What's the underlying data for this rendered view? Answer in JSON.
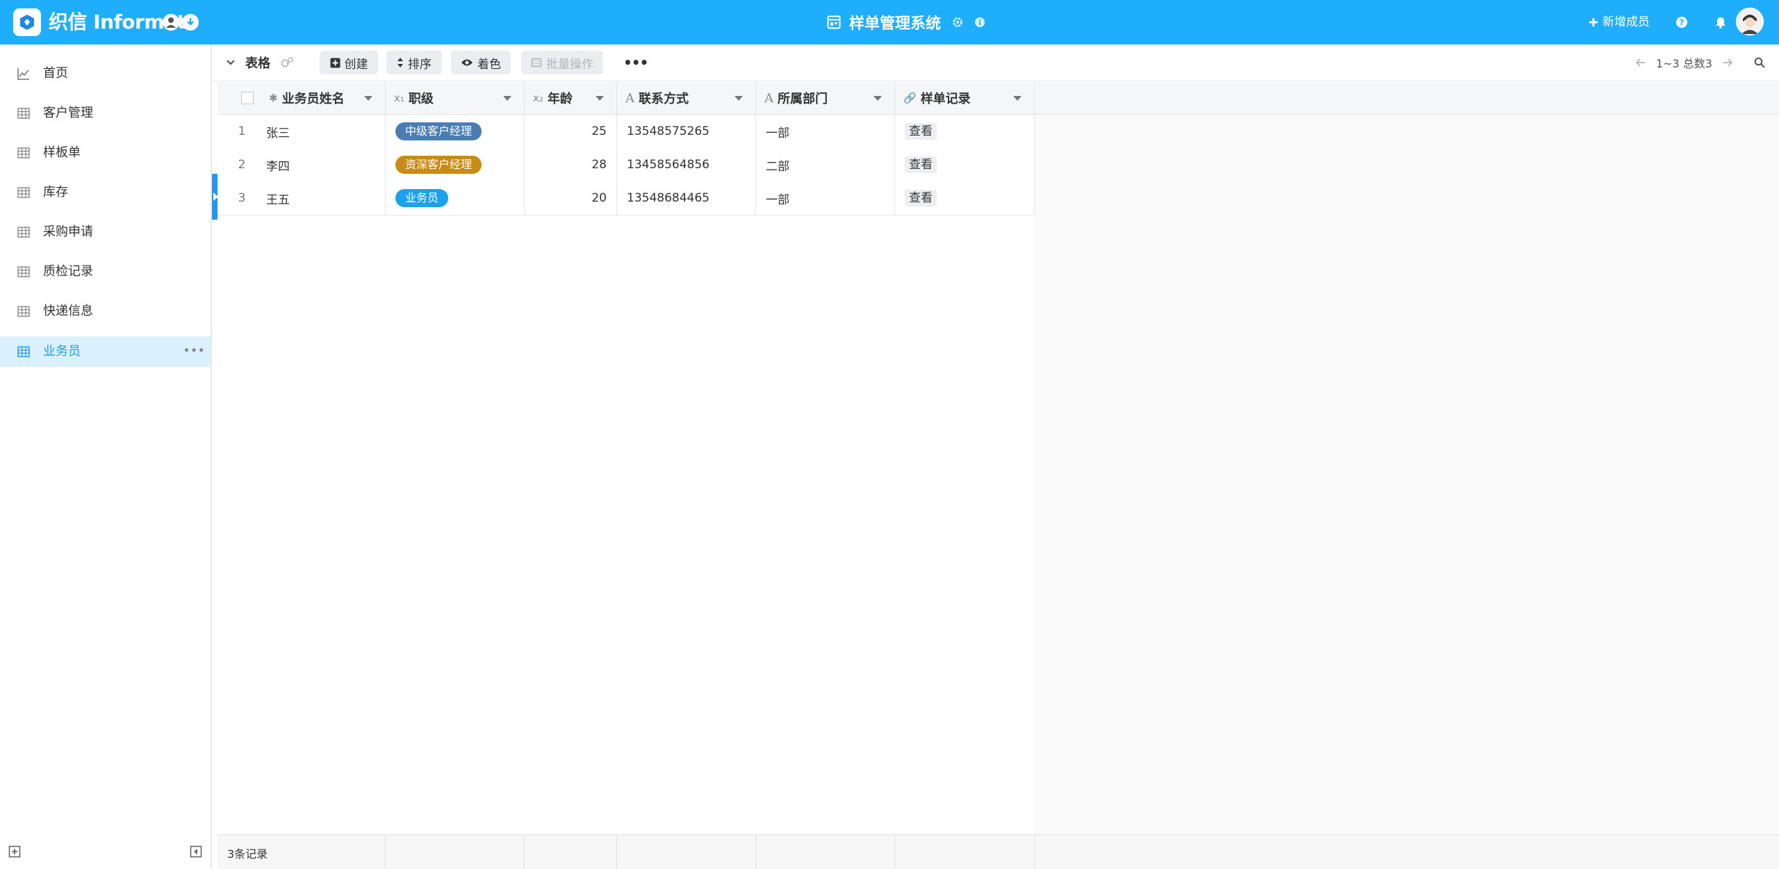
{
  "header": {
    "brand": "织信 Informat",
    "app_title": "样单管理系统",
    "add_member": "新增成员"
  },
  "sidebar": {
    "items": [
      {
        "label": "首页",
        "icon": "chart-line-icon"
      },
      {
        "label": "客户管理",
        "icon": "table-icon"
      },
      {
        "label": "样板单",
        "icon": "table-icon"
      },
      {
        "label": "库存",
        "icon": "table-icon"
      },
      {
        "label": "采购申请",
        "icon": "table-icon"
      },
      {
        "label": "质检记录",
        "icon": "table-icon"
      },
      {
        "label": "快递信息",
        "icon": "table-icon"
      },
      {
        "label": "业务员",
        "icon": "table-icon",
        "active": true
      }
    ]
  },
  "toolbar": {
    "view_name": "表格",
    "create": "创建",
    "sort": "排序",
    "color": "着色",
    "batch": "批量操作",
    "pager": "1~3 总数3"
  },
  "table": {
    "columns": [
      {
        "label": "业务员姓名",
        "type": "✱"
      },
      {
        "label": "职级",
        "type": "x₁"
      },
      {
        "label": "年龄",
        "type": "x₂"
      },
      {
        "label": "联系方式",
        "type": "A"
      },
      {
        "label": "所属部门",
        "type": "A"
      },
      {
        "label": "样单记录",
        "type": "🔗"
      }
    ],
    "rows": [
      {
        "num": "1",
        "name": "张三",
        "level": "中级客户经理",
        "level_color": "#4a7db4",
        "age": "25",
        "phone": "13548575265",
        "dept": "一部",
        "record": "查看"
      },
      {
        "num": "2",
        "name": "李四",
        "level": "资深客户经理",
        "level_color": "#c98b14",
        "age": "28",
        "phone": "13458564856",
        "dept": "二部",
        "record": "查看"
      },
      {
        "num": "3",
        "name": "王五",
        "level": "业务员",
        "level_color": "#1ba1ee",
        "age": "20",
        "phone": "13548684465",
        "dept": "一部",
        "record": "查看"
      }
    ]
  },
  "footer": {
    "count": "3条记录"
  },
  "colors": {
    "header_bg": "#1eaefc",
    "active_nav_bg": "#dbf1fd",
    "active_nav_text": "#1e9bea"
  }
}
